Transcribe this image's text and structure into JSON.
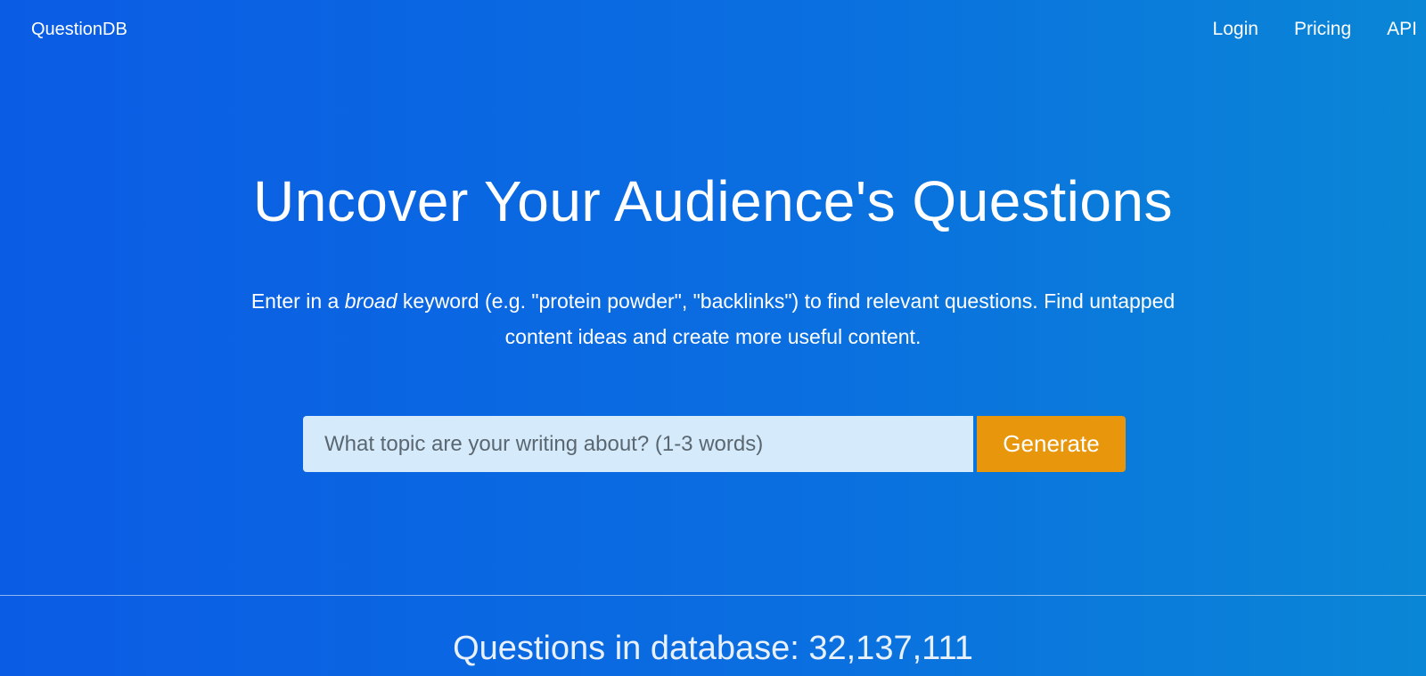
{
  "navbar": {
    "brand": "QuestionDB",
    "links": [
      {
        "label": "Login"
      },
      {
        "label": "Pricing"
      },
      {
        "label": "API"
      }
    ]
  },
  "hero": {
    "title": "Uncover Your Audience's Questions",
    "subtitle_before": "Enter in a ",
    "subtitle_emphasis": "broad",
    "subtitle_after": " keyword (e.g. \"protein powder\", \"backlinks\") to find relevant questions. Find untapped content ideas and create more useful content."
  },
  "search": {
    "placeholder": "What topic are your writing about? (1-3 words)",
    "value": "",
    "button_label": "Generate"
  },
  "stats": {
    "questions_label": "Questions in database: 32,137,111"
  },
  "colors": {
    "gradient_start": "#0b5ce4",
    "gradient_end": "#0a86d6",
    "input_background": "#d5ebfb",
    "button_accent": "#e8960c"
  }
}
